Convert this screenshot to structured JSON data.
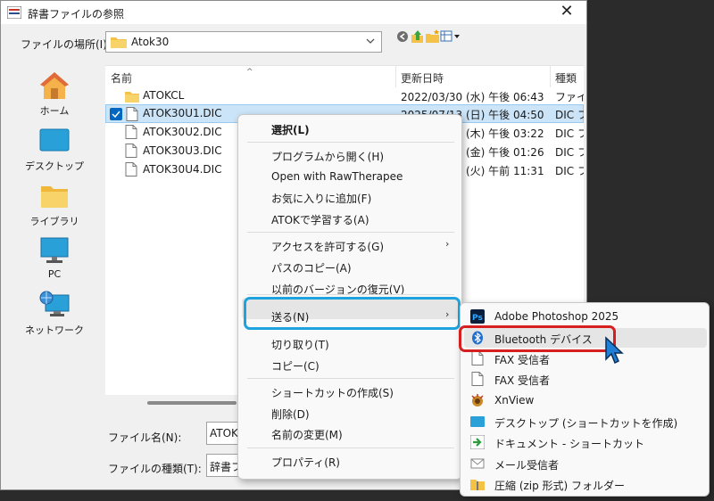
{
  "dialog": {
    "title": "辞書ファイルの参照"
  },
  "location": {
    "label": "ファイルの場所(I):",
    "value": "Atok30"
  },
  "toolbar_icons": [
    "back-icon",
    "up-folder-icon",
    "new-folder-icon",
    "view-menu-icon"
  ],
  "places": [
    {
      "label": "ホーム",
      "icon": "home-icon"
    },
    {
      "label": "デスクトップ",
      "icon": "desktop-icon"
    },
    {
      "label": "ライブラリ",
      "icon": "library-icon"
    },
    {
      "label": "PC",
      "icon": "pc-icon"
    },
    {
      "label": "ネットワーク",
      "icon": "network-icon"
    }
  ],
  "file_list": {
    "columns": [
      "名前",
      "更新日時",
      "種類"
    ],
    "rows": [
      {
        "name": "ATOKCL",
        "date": "2022/03/30 (水) 午後 06:43",
        "type": "ファイル",
        "icon": "folder-icon",
        "selected": false
      },
      {
        "name": "ATOK30U1.DIC",
        "date": "2025/07/13 (日) 午後 04:50",
        "type": "DIC フ",
        "icon": "file-icon",
        "selected": true
      },
      {
        "name": "ATOK30U2.DIC",
        "date": "(木) 午後 03:22",
        "type": "DIC フ",
        "icon": "file-icon",
        "selected": false
      },
      {
        "name": "ATOK30U3.DIC",
        "date": "(金) 午後 01:26",
        "type": "DIC フ",
        "icon": "file-icon",
        "selected": false
      },
      {
        "name": "ATOK30U4.DIC",
        "date": "(火) 午前 11:31",
        "type": "DIC フ",
        "icon": "file-icon",
        "selected": false
      }
    ]
  },
  "filename": {
    "label": "ファイル名(N):",
    "value": "ATOK"
  },
  "filetype": {
    "label": "ファイルの種類(T):",
    "value": "辞書フ"
  },
  "context_menu": {
    "items": [
      "選択(L)",
      "プログラムから開く(H)",
      "Open with RawTherapee",
      "お気に入りに追加(F)",
      "ATOKで学習する(A)",
      "アクセスを許可する(G)",
      "パスのコピー(A)",
      "以前のバージョンの復元(V)",
      "送る(N)",
      "切り取り(T)",
      "コピー(C)",
      "ショートカットの作成(S)",
      "削除(D)",
      "名前の変更(M)",
      "プロパティ(R)"
    ],
    "submenu_arrow": "›"
  },
  "send_to_menu": {
    "items": [
      {
        "label": "Adobe Photoshop 2025",
        "icon": "photoshop-icon"
      },
      {
        "label": "Bluetooth デバイス",
        "icon": "bluetooth-icon"
      },
      {
        "label": "FAX 受信者",
        "icon": "fax-document-icon"
      },
      {
        "label": "FAX 受信者",
        "icon": "fax-document-icon"
      },
      {
        "label": "XnView",
        "icon": "xnview-icon"
      },
      {
        "label": "デスクトップ (ショートカットを作成)",
        "icon": "desktop-icon"
      },
      {
        "label": "ドキュメント - ショートカット",
        "icon": "shortcut-arrow-icon"
      },
      {
        "label": "メール受信者",
        "icon": "mail-icon"
      },
      {
        "label": "圧縮 (zip 形式) フォルダー",
        "icon": "zip-folder-icon"
      }
    ]
  },
  "colors": {
    "highlight_send_to": "#1fa3de",
    "highlight_bluetooth": "#d62020",
    "selection": "#cce4f7",
    "accent": "#0067c0"
  }
}
